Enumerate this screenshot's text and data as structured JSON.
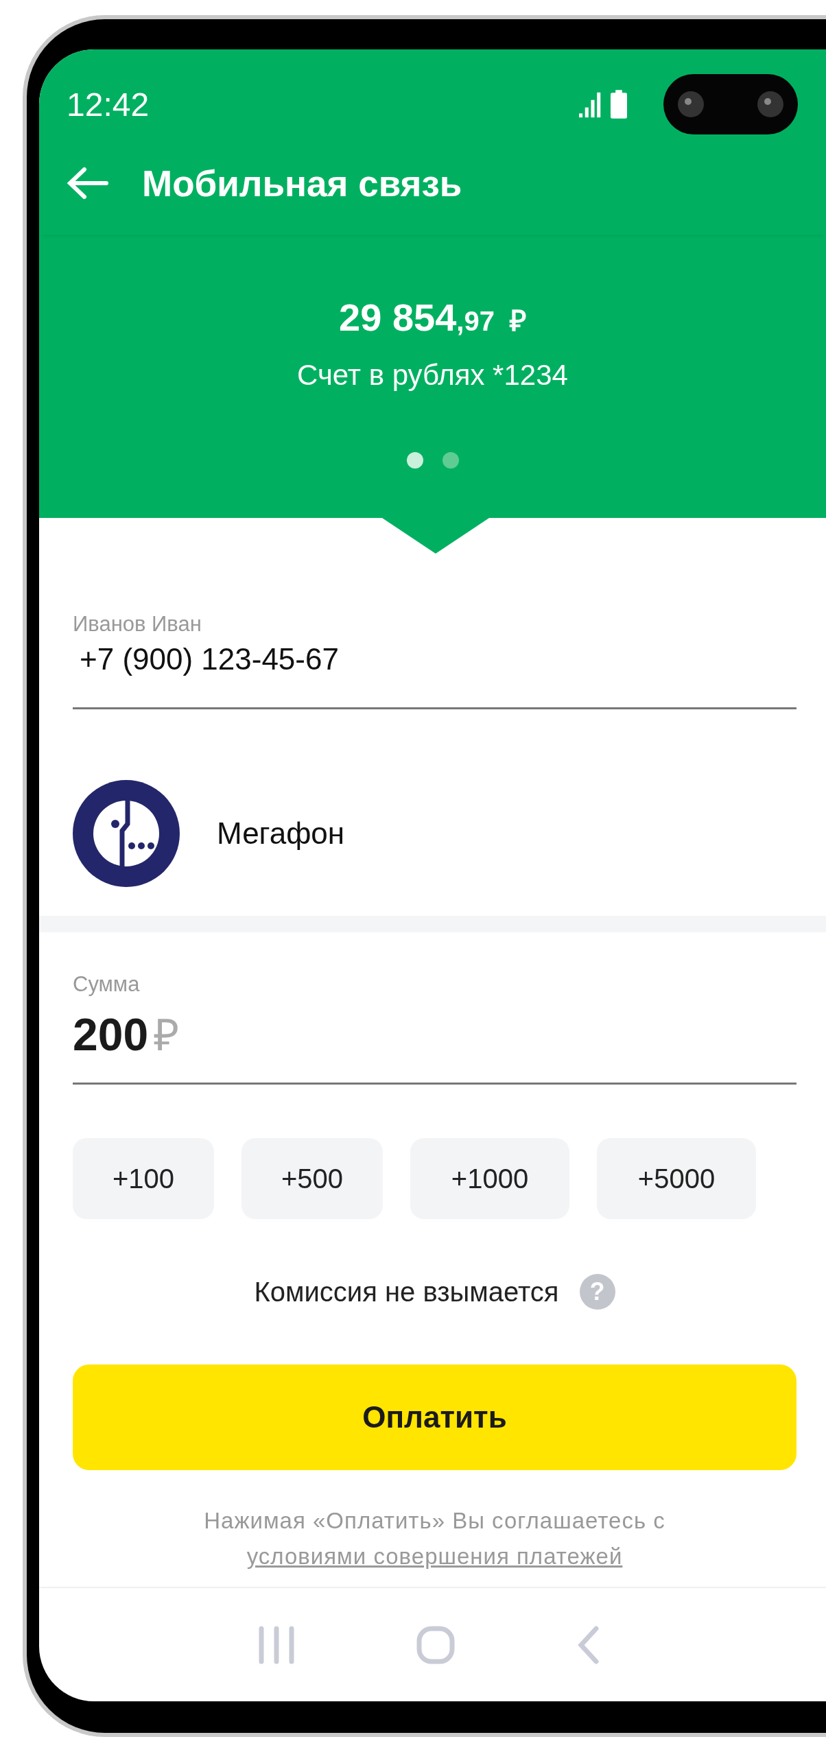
{
  "status_bar": {
    "time": "12:42"
  },
  "header": {
    "title": "Мобильная связь"
  },
  "account": {
    "amount_whole": "29 854",
    "amount_fraction": ",97",
    "currency": "₽",
    "name": "Счет в рублях *1234",
    "pages": [
      {
        "selected": true
      },
      {
        "selected": false
      }
    ]
  },
  "phone_field": {
    "label": "Иванов Иван",
    "value": "+7 (900) 123-45-67"
  },
  "operator": {
    "name": "Мегафон"
  },
  "amount_field": {
    "label": "Сумма",
    "value": "200",
    "currency": "₽"
  },
  "quick_amounts": [
    "+100",
    "+500",
    "+1000",
    "+5000"
  ],
  "commission": {
    "text": "Комиссия не взымается",
    "help_icon": "?"
  },
  "pay_button": "Оплатить",
  "disclaimer": {
    "text": "Нажимая «Оплатить» Вы соглашаетесь с",
    "link": "условиями совершения платежей"
  }
}
